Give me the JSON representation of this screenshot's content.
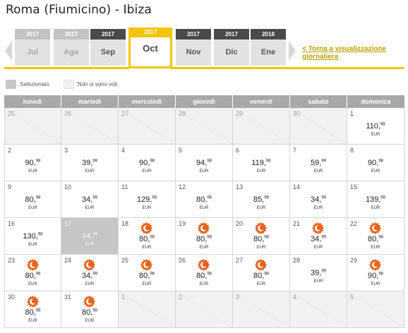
{
  "header": {
    "route": "Roma (Fiumicino) - Ibiza"
  },
  "months": [
    {
      "year": "2017",
      "month": "Jul",
      "state": "inactive"
    },
    {
      "year": "2017",
      "month": "Ago",
      "state": "inactive"
    },
    {
      "year": "2017",
      "month": "Sep",
      "state": "available"
    },
    {
      "year": "2017",
      "month": "Oct",
      "state": "selected"
    },
    {
      "year": "2017",
      "month": "Nov",
      "state": "available"
    },
    {
      "year": "2017",
      "month": "Dic",
      "state": "available"
    },
    {
      "year": "2018",
      "month": "Ene",
      "state": "available"
    }
  ],
  "back_link": "< Torna a visualizzazione giornaliera",
  "legend": {
    "selected": "Selezionato",
    "no_flights": "Non ci sono voli"
  },
  "weekdays": [
    "lunedì",
    "martedì",
    "mercoledì",
    "giovedì",
    "venerdì",
    "sabato",
    "domenica"
  ],
  "currency": "EUR",
  "colors": {
    "accent": "#f3c400",
    "offer": "#e8641c",
    "header_bg": "#a8a8a8"
  },
  "weeks": [
    [
      {
        "day": "25",
        "other": true
      },
      {
        "day": "26",
        "other": true
      },
      {
        "day": "27",
        "other": true
      },
      {
        "day": "28",
        "other": true
      },
      {
        "day": "29",
        "other": true
      },
      {
        "day": "30",
        "other": true
      },
      {
        "day": "1",
        "int": "110",
        "dec": "98"
      }
    ],
    [
      {
        "day": "2",
        "int": "90",
        "dec": "98"
      },
      {
        "day": "3",
        "int": "39",
        "dec": "99"
      },
      {
        "day": "4",
        "int": "90",
        "dec": "98"
      },
      {
        "day": "5",
        "int": "94",
        "dec": "98"
      },
      {
        "day": "6",
        "int": "119",
        "dec": "98"
      },
      {
        "day": "7",
        "int": "59",
        "dec": "99"
      },
      {
        "day": "8",
        "int": "90",
        "dec": "98"
      }
    ],
    [
      {
        "day": "9",
        "int": "80",
        "dec": "98"
      },
      {
        "day": "10",
        "int": "34",
        "dec": "99"
      },
      {
        "day": "11",
        "int": "129",
        "dec": "98"
      },
      {
        "day": "12",
        "int": "80",
        "dec": "98"
      },
      {
        "day": "13",
        "int": "85",
        "dec": "98"
      },
      {
        "day": "14",
        "int": "34",
        "dec": "99"
      },
      {
        "day": "15",
        "int": "139",
        "dec": "98"
      }
    ],
    [
      {
        "day": "16",
        "int": "130",
        "dec": "98"
      },
      {
        "day": "17",
        "int": "34",
        "dec": "99",
        "selected": true
      },
      {
        "day": "18",
        "int": "80",
        "dec": "98",
        "offer": true
      },
      {
        "day": "19",
        "int": "80",
        "dec": "98",
        "offer": true
      },
      {
        "day": "20",
        "int": "80",
        "dec": "98",
        "offer": true
      },
      {
        "day": "21",
        "int": "34",
        "dec": "99",
        "offer": true
      },
      {
        "day": "22",
        "int": "80",
        "dec": "98",
        "offer": true
      }
    ],
    [
      {
        "day": "23",
        "int": "80",
        "dec": "98",
        "offer": true
      },
      {
        "day": "24",
        "int": "34",
        "dec": "99",
        "offer": true
      },
      {
        "day": "25",
        "int": "80",
        "dec": "98",
        "offer": true
      },
      {
        "day": "26",
        "int": "80",
        "dec": "98",
        "offer": true
      },
      {
        "day": "27",
        "int": "80",
        "dec": "98",
        "offer": true
      },
      {
        "day": "28",
        "int": "39",
        "dec": "99"
      },
      {
        "day": "29",
        "int": "90",
        "dec": "98",
        "offer": true
      }
    ],
    [
      {
        "day": "30",
        "int": "80",
        "dec": "98",
        "offer": true
      },
      {
        "day": "31",
        "int": "80",
        "dec": "98",
        "offer": true
      },
      {
        "day": "1",
        "other": true
      },
      {
        "day": "2",
        "other": true
      },
      {
        "day": "3",
        "other": true
      },
      {
        "day": "4",
        "other": true
      },
      {
        "day": "5",
        "other": true
      }
    ]
  ]
}
